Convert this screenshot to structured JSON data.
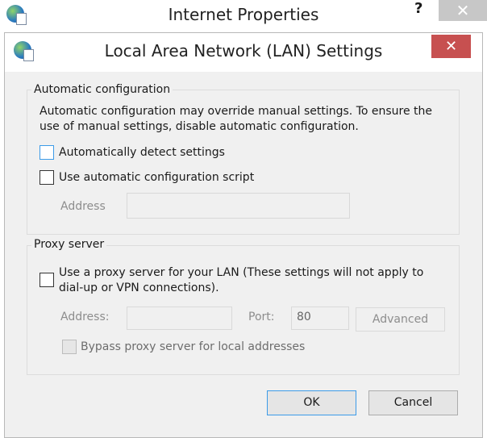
{
  "outer_window": {
    "title": "Internet Properties",
    "help": "?",
    "close": "✕"
  },
  "dialog": {
    "title": "Local Area Network (LAN) Settings",
    "close": "✕",
    "auto_config": {
      "legend": "Automatic configuration",
      "description": "Automatic configuration may override manual settings.  To ensure the use of manual settings, disable automatic configuration.",
      "auto_detect": {
        "label": "Automatically detect settings",
        "checked": false
      },
      "auto_script": {
        "label": "Use automatic configuration script",
        "checked": false
      },
      "address_label": "Address",
      "address_value": ""
    },
    "proxy": {
      "legend": "Proxy server",
      "use_proxy": {
        "label_line1": "Use a proxy server for your LAN (These settings will not apply to",
        "label_line2": "dial-up or VPN connections).",
        "checked": false
      },
      "address_label": "Address:",
      "address_value": "",
      "port_label": "Port:",
      "port_value": "80",
      "advanced": "Advanced",
      "bypass": {
        "label": "Bypass proxy server for local addresses",
        "checked": false
      }
    },
    "ok": "OK",
    "cancel": "Cancel"
  },
  "colors": {
    "close_red": "#c75050",
    "focus_blue": "#3c9be8",
    "body": "#f0f0f0"
  }
}
